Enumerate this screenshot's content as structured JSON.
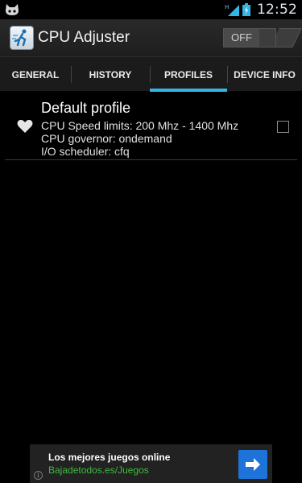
{
  "status_bar": {
    "time": "12:52",
    "notification_icon": "cat-icon",
    "network_label": "H",
    "icons": [
      "signal-icon",
      "battery-icon"
    ]
  },
  "action_bar": {
    "title": "CPU Adjuster",
    "app_icon": "cpu-adjuster-app-icon",
    "toggle_label": "OFF"
  },
  "tabs": [
    {
      "label": "GENERAL",
      "active": false
    },
    {
      "label": "HISTORY",
      "active": false
    },
    {
      "label": "PROFILES",
      "active": true
    },
    {
      "label": "DEVICE INFO",
      "active": false
    }
  ],
  "profiles": [
    {
      "name": "Default profile",
      "speed": "CPU Speed limits: 200 Mhz - 1400 Mhz",
      "governor": "CPU governor: ondemand",
      "scheduler": "I/O scheduler: cfq",
      "icon": "heart-icon",
      "checked": false
    }
  ],
  "ad": {
    "title": "Los mejores juegos online",
    "url": "Bajadetodos.es/Juegos",
    "info_glyph": "i",
    "button_icon": "arrow-right-icon"
  },
  "colors": {
    "accent": "#33b5e5",
    "ad_url": "#3dbb3d",
    "ad_button": "#1e73d8"
  }
}
